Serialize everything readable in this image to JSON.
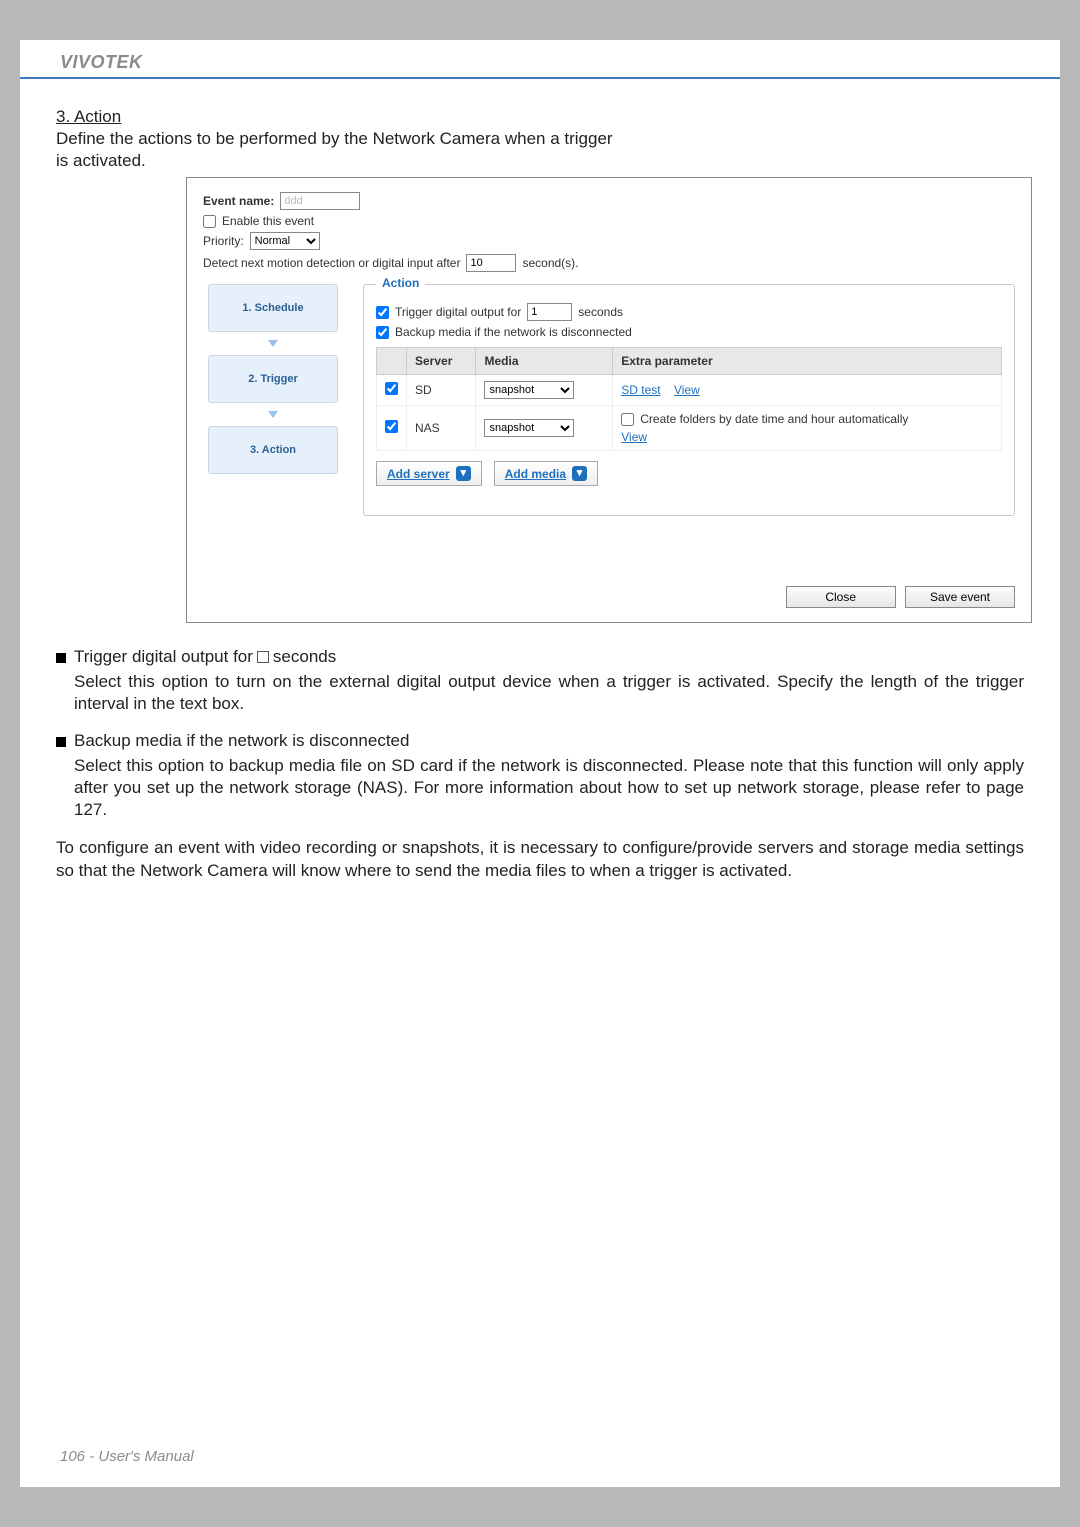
{
  "brand": "VIVOTEK",
  "section_title": "3. Action",
  "intro_text_1": "Define the actions to be performed by the Network Camera when a trigger",
  "intro_text_2": "is activated.",
  "panel": {
    "event_name_label": "Event name:",
    "event_name_value": "ddd",
    "enable_label": "Enable this event",
    "enable_checked": false,
    "priority_label": "Priority:",
    "priority_value": "Normal",
    "detect_label_before": "Detect next motion detection or digital input after",
    "detect_value": "10",
    "detect_label_after": "second(s).",
    "steps": [
      "1.  Schedule",
      "2.  Trigger",
      "3.  Action"
    ],
    "action": {
      "legend": "Action",
      "trigger_out_label_before": "Trigger digital output for",
      "trigger_out_value": "1",
      "trigger_out_label_after": "seconds",
      "backup_label": "Backup media if the network is disconnected",
      "headers": {
        "server": "Server",
        "media": "Media",
        "extra": "Extra parameter"
      },
      "rows": [
        {
          "checked": true,
          "server": "SD",
          "media": "snapshot",
          "extra_links": [
            "SD test",
            "View"
          ],
          "create_folders": null
        },
        {
          "checked": true,
          "server": "NAS",
          "media": "snapshot",
          "extra_links": [
            "View"
          ],
          "create_folders": {
            "checked": false,
            "label": "Create folders by date time and hour automatically"
          }
        }
      ],
      "add_server": "Add server",
      "add_media": "Add media"
    },
    "close_btn": "Close",
    "save_btn": "Save event"
  },
  "bullets": [
    {
      "title_before": "Trigger digital output for",
      "has_checkbox": true,
      "title_after": "seconds",
      "body": "Select this option to turn on the external digital output device when a trigger is activated. Specify the length of the trigger interval in the text box."
    },
    {
      "title_before": "Backup media if the network is disconnected",
      "has_checkbox": false,
      "title_after": "",
      "body": "Select this option to backup media file on SD card if the network is disconnected. Please note that this function will only apply after you set up the network storage (NAS). For more information about how to set up network storage, please refer to page 127."
    }
  ],
  "paragraph": "To configure an event with video recording or snapshots, it is necessary to configure/provide servers and storage media settings so that the Network Camera will know where to send the media files to when a trigger is activated.",
  "footer": "106 - User's Manual"
}
